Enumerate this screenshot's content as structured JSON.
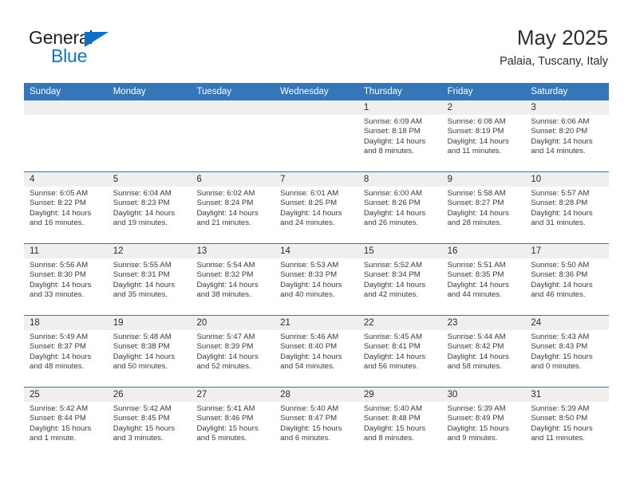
{
  "brand": {
    "name_top": "General",
    "name_bottom": "Blue",
    "triangle_color": "#0f6fc0",
    "blue_color": "#1574bd"
  },
  "header": {
    "title": "May 2025",
    "subtitle": "Palaia, Tuscany, Italy"
  },
  "theme": {
    "header_blue": "#3576b8",
    "date_band": "#efefef",
    "text": "#3a3a3a"
  },
  "weekdays": [
    "Sunday",
    "Monday",
    "Tuesday",
    "Wednesday",
    "Thursday",
    "Friday",
    "Saturday"
  ],
  "weeks": [
    [
      {
        "date": "",
        "empty": true
      },
      {
        "date": "",
        "empty": true
      },
      {
        "date": "",
        "empty": true
      },
      {
        "date": "",
        "empty": true
      },
      {
        "date": "1",
        "sunrise": "Sunrise: 6:09 AM",
        "sunset": "Sunset: 8:18 PM",
        "daylight1": "Daylight: 14 hours",
        "daylight2": "and 8 minutes."
      },
      {
        "date": "2",
        "sunrise": "Sunrise: 6:08 AM",
        "sunset": "Sunset: 8:19 PM",
        "daylight1": "Daylight: 14 hours",
        "daylight2": "and 11 minutes."
      },
      {
        "date": "3",
        "sunrise": "Sunrise: 6:06 AM",
        "sunset": "Sunset: 8:20 PM",
        "daylight1": "Daylight: 14 hours",
        "daylight2": "and 14 minutes."
      }
    ],
    [
      {
        "date": "4",
        "sunrise": "Sunrise: 6:05 AM",
        "sunset": "Sunset: 8:22 PM",
        "daylight1": "Daylight: 14 hours",
        "daylight2": "and 16 minutes."
      },
      {
        "date": "5",
        "sunrise": "Sunrise: 6:04 AM",
        "sunset": "Sunset: 8:23 PM",
        "daylight1": "Daylight: 14 hours",
        "daylight2": "and 19 minutes."
      },
      {
        "date": "6",
        "sunrise": "Sunrise: 6:02 AM",
        "sunset": "Sunset: 8:24 PM",
        "daylight1": "Daylight: 14 hours",
        "daylight2": "and 21 minutes."
      },
      {
        "date": "7",
        "sunrise": "Sunrise: 6:01 AM",
        "sunset": "Sunset: 8:25 PM",
        "daylight1": "Daylight: 14 hours",
        "daylight2": "and 24 minutes."
      },
      {
        "date": "8",
        "sunrise": "Sunrise: 6:00 AM",
        "sunset": "Sunset: 8:26 PM",
        "daylight1": "Daylight: 14 hours",
        "daylight2": "and 26 minutes."
      },
      {
        "date": "9",
        "sunrise": "Sunrise: 5:58 AM",
        "sunset": "Sunset: 8:27 PM",
        "daylight1": "Daylight: 14 hours",
        "daylight2": "and 28 minutes."
      },
      {
        "date": "10",
        "sunrise": "Sunrise: 5:57 AM",
        "sunset": "Sunset: 8:28 PM",
        "daylight1": "Daylight: 14 hours",
        "daylight2": "and 31 minutes."
      }
    ],
    [
      {
        "date": "11",
        "sunrise": "Sunrise: 5:56 AM",
        "sunset": "Sunset: 8:30 PM",
        "daylight1": "Daylight: 14 hours",
        "daylight2": "and 33 minutes."
      },
      {
        "date": "12",
        "sunrise": "Sunrise: 5:55 AM",
        "sunset": "Sunset: 8:31 PM",
        "daylight1": "Daylight: 14 hours",
        "daylight2": "and 35 minutes."
      },
      {
        "date": "13",
        "sunrise": "Sunrise: 5:54 AM",
        "sunset": "Sunset: 8:32 PM",
        "daylight1": "Daylight: 14 hours",
        "daylight2": "and 38 minutes."
      },
      {
        "date": "14",
        "sunrise": "Sunrise: 5:53 AM",
        "sunset": "Sunset: 8:33 PM",
        "daylight1": "Daylight: 14 hours",
        "daylight2": "and 40 minutes."
      },
      {
        "date": "15",
        "sunrise": "Sunrise: 5:52 AM",
        "sunset": "Sunset: 8:34 PM",
        "daylight1": "Daylight: 14 hours",
        "daylight2": "and 42 minutes."
      },
      {
        "date": "16",
        "sunrise": "Sunrise: 5:51 AM",
        "sunset": "Sunset: 8:35 PM",
        "daylight1": "Daylight: 14 hours",
        "daylight2": "and 44 minutes."
      },
      {
        "date": "17",
        "sunrise": "Sunrise: 5:50 AM",
        "sunset": "Sunset: 8:36 PM",
        "daylight1": "Daylight: 14 hours",
        "daylight2": "and 46 minutes."
      }
    ],
    [
      {
        "date": "18",
        "sunrise": "Sunrise: 5:49 AM",
        "sunset": "Sunset: 8:37 PM",
        "daylight1": "Daylight: 14 hours",
        "daylight2": "and 48 minutes."
      },
      {
        "date": "19",
        "sunrise": "Sunrise: 5:48 AM",
        "sunset": "Sunset: 8:38 PM",
        "daylight1": "Daylight: 14 hours",
        "daylight2": "and 50 minutes."
      },
      {
        "date": "20",
        "sunrise": "Sunrise: 5:47 AM",
        "sunset": "Sunset: 8:39 PM",
        "daylight1": "Daylight: 14 hours",
        "daylight2": "and 52 minutes."
      },
      {
        "date": "21",
        "sunrise": "Sunrise: 5:46 AM",
        "sunset": "Sunset: 8:40 PM",
        "daylight1": "Daylight: 14 hours",
        "daylight2": "and 54 minutes."
      },
      {
        "date": "22",
        "sunrise": "Sunrise: 5:45 AM",
        "sunset": "Sunset: 8:41 PM",
        "daylight1": "Daylight: 14 hours",
        "daylight2": "and 56 minutes."
      },
      {
        "date": "23",
        "sunrise": "Sunrise: 5:44 AM",
        "sunset": "Sunset: 8:42 PM",
        "daylight1": "Daylight: 14 hours",
        "daylight2": "and 58 minutes."
      },
      {
        "date": "24",
        "sunrise": "Sunrise: 5:43 AM",
        "sunset": "Sunset: 8:43 PM",
        "daylight1": "Daylight: 15 hours",
        "daylight2": "and 0 minutes."
      }
    ],
    [
      {
        "date": "25",
        "sunrise": "Sunrise: 5:42 AM",
        "sunset": "Sunset: 8:44 PM",
        "daylight1": "Daylight: 15 hours",
        "daylight2": "and 1 minute."
      },
      {
        "date": "26",
        "sunrise": "Sunrise: 5:42 AM",
        "sunset": "Sunset: 8:45 PM",
        "daylight1": "Daylight: 15 hours",
        "daylight2": "and 3 minutes."
      },
      {
        "date": "27",
        "sunrise": "Sunrise: 5:41 AM",
        "sunset": "Sunset: 8:46 PM",
        "daylight1": "Daylight: 15 hours",
        "daylight2": "and 5 minutes."
      },
      {
        "date": "28",
        "sunrise": "Sunrise: 5:40 AM",
        "sunset": "Sunset: 8:47 PM",
        "daylight1": "Daylight: 15 hours",
        "daylight2": "and 6 minutes."
      },
      {
        "date": "29",
        "sunrise": "Sunrise: 5:40 AM",
        "sunset": "Sunset: 8:48 PM",
        "daylight1": "Daylight: 15 hours",
        "daylight2": "and 8 minutes."
      },
      {
        "date": "30",
        "sunrise": "Sunrise: 5:39 AM",
        "sunset": "Sunset: 8:49 PM",
        "daylight1": "Daylight: 15 hours",
        "daylight2": "and 9 minutes."
      },
      {
        "date": "31",
        "sunrise": "Sunrise: 5:39 AM",
        "sunset": "Sunset: 8:50 PM",
        "daylight1": "Daylight: 15 hours",
        "daylight2": "and 11 minutes."
      }
    ]
  ]
}
